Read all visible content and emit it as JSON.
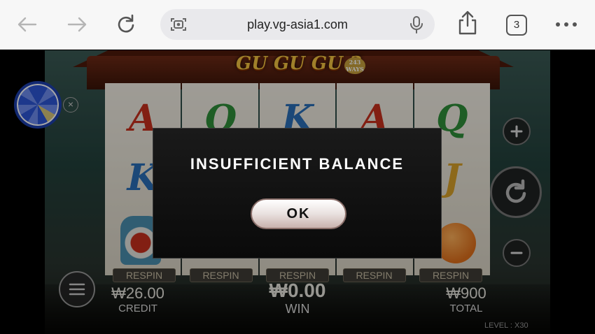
{
  "browser": {
    "url": "play.vg-asia1.com",
    "tab_count": "3",
    "icons": [
      "back-arrow-icon",
      "forward-arrow-icon",
      "reload-icon",
      "screen-capture-icon",
      "microphone-icon",
      "share-icon",
      "more-icon"
    ]
  },
  "game": {
    "title": "GU GU GU 3",
    "ways_badge": "243 WAYS",
    "reels": [
      {
        "top": "A",
        "mid": "K",
        "bottom": "vase",
        "top_color": "#c8301e",
        "mid_color": "#2a6fb8"
      },
      {
        "top": "Q",
        "mid": "",
        "bottom": "",
        "top_color": "#2f8f3a"
      },
      {
        "top": "K",
        "mid": "",
        "bottom": "",
        "top_color": "#2a6fb8"
      },
      {
        "top": "A",
        "mid": "",
        "bottom": "",
        "top_color": "#c8301e"
      },
      {
        "top": "Q",
        "mid": "J",
        "bottom": "orange",
        "top_color": "#2f8f3a",
        "mid_color": "#d9a22a"
      }
    ],
    "respin_labels": [
      "RESPIN",
      "RESPIN",
      "RESPIN",
      "RESPIN",
      "RESPIN"
    ],
    "credit_value": "₩26.00",
    "credit_label": "CREDIT",
    "win_value": "₩0.00",
    "win_label": "WIN",
    "total_value": "₩900",
    "total_label": "TOTAL",
    "level_text": "LEVEL : X30"
  },
  "dialog": {
    "message": "INSUFFICIENT BALANCE",
    "ok_label": "OK"
  }
}
